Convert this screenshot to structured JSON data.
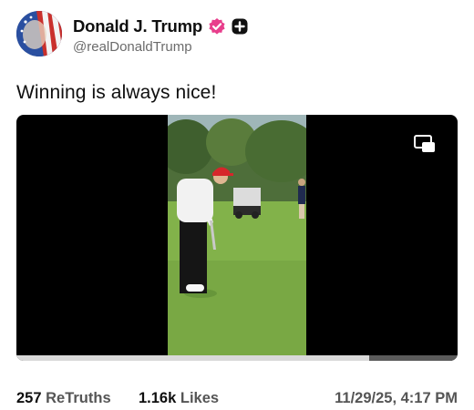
{
  "post": {
    "author_name": "Donald J. Trump",
    "author_handle": "@realDonaldTrump",
    "text": "Winning is always nice!",
    "retruths_count": "257",
    "retruths_label": "ReTruths",
    "likes_count": "1.16k",
    "likes_label": "Likes",
    "timestamp": "11/29/25, 4:17 PM",
    "video_progress": 0.8
  },
  "icons": {
    "verified": "verified-badge-icon",
    "add": "add-icon",
    "pip": "picture-in-picture-icon"
  },
  "colors": {
    "verified_badge": "#e83e8c",
    "progress_fill": "#d9d9d9",
    "progress_track": "#5b5b5b"
  }
}
